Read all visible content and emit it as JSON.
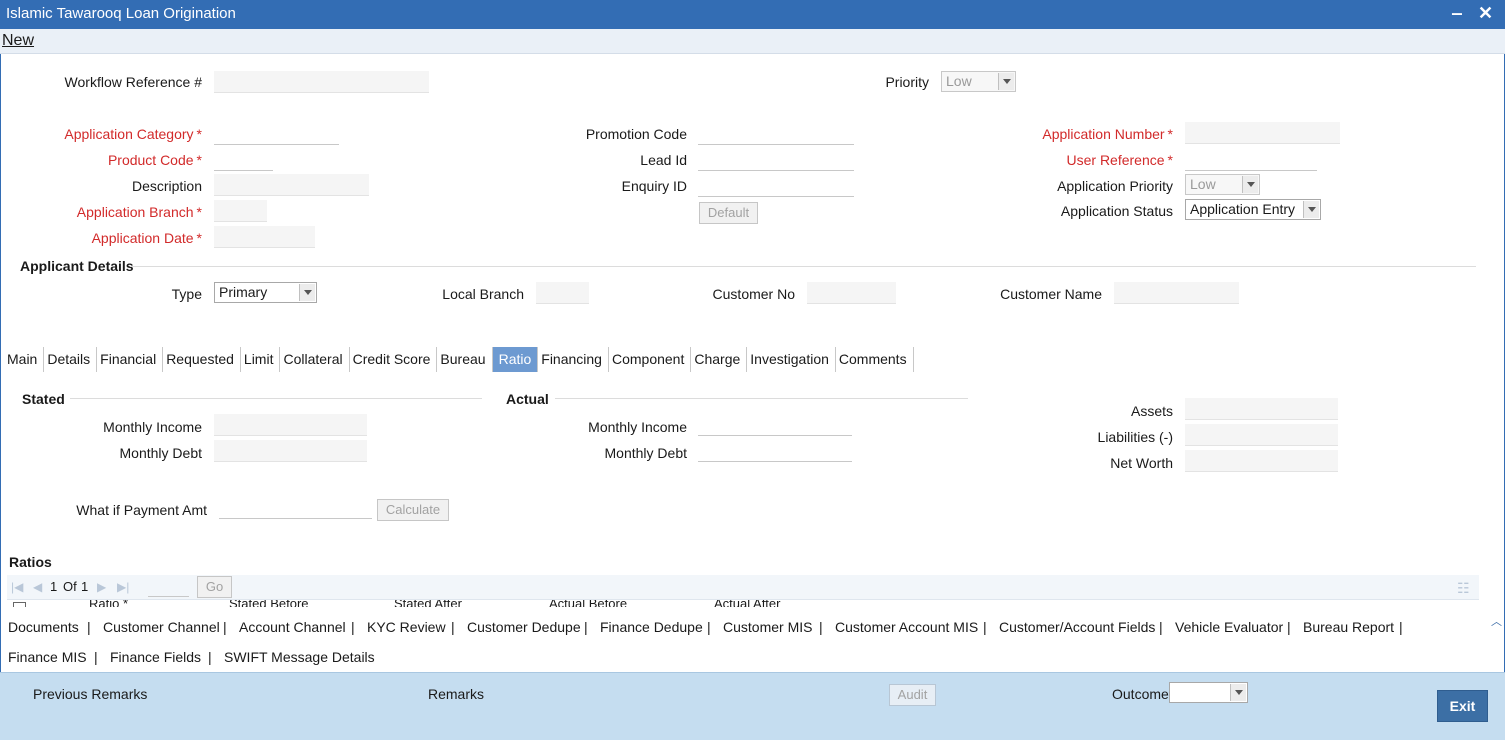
{
  "window": {
    "title": "Islamic Tawarooq Loan Origination",
    "minimize": "‒",
    "close": "✕"
  },
  "menu": {
    "new": "New"
  },
  "header": {
    "workflow_ref_label": "Workflow Reference #",
    "workflow_ref_value": "",
    "priority_label": "Priority",
    "priority_value": "Low"
  },
  "app": {
    "category_label": "Application Category",
    "product_code_label": "Product Code",
    "description_label": "Description",
    "branch_label": "Application Branch",
    "date_label": "Application Date",
    "promotion_code_label": "Promotion Code",
    "lead_id_label": "Lead Id",
    "enquiry_id_label": "Enquiry ID",
    "default_button": "Default",
    "app_number_label": "Application Number",
    "user_reference_label": "User Reference",
    "app_priority_label": "Application Priority",
    "app_priority_value": "Low",
    "app_status_label": "Application Status",
    "app_status_value": "Application Entry",
    "required_mark": "*"
  },
  "applicant": {
    "section_title": "Applicant Details",
    "type_label": "Type",
    "type_value": "Primary",
    "local_branch_label": "Local Branch",
    "customer_no_label": "Customer No",
    "customer_name_label": "Customer Name"
  },
  "tabs": [
    "Main",
    "Details",
    "Financial",
    "Requested",
    "Limit",
    "Collateral",
    "Credit Score",
    "Bureau",
    "Ratio",
    "Financing",
    "Component",
    "Charge",
    "Investigation",
    "Comments"
  ],
  "active_tab": "Ratio",
  "ratio": {
    "stated_title": "Stated",
    "actual_title": "Actual",
    "monthly_income_label": "Monthly Income",
    "monthly_debt_label": "Monthly Debt",
    "assets_label": "Assets",
    "liabilities_label": "Liabilities (-)",
    "net_worth_label": "Net Worth",
    "what_if_label": "What if Payment Amt",
    "calculate_button": "Calculate",
    "ratios_title": "Ratios",
    "pager_current": "1",
    "pager_of": "Of",
    "pager_total": "1",
    "go_button": "Go",
    "columns": [
      "Ratio *",
      "Stated Before",
      "Stated After",
      "Actual Before",
      "Actual After"
    ]
  },
  "links_row1": [
    "Documents",
    "Customer Channel",
    "Account Channel",
    "KYC Review",
    "Customer Dedupe",
    "Finance Dedupe",
    "Customer MIS",
    "Customer Account MIS",
    "Customer/Account Fields",
    "Vehicle Evaluator",
    "Bureau Report"
  ],
  "links_row2": [
    "Finance MIS",
    "Finance Fields",
    "SWIFT Message Details"
  ],
  "separator": "|",
  "footer": {
    "previous_remarks": "Previous Remarks",
    "remarks": "Remarks",
    "audit_button": "Audit",
    "outcome_label": "Outcome",
    "outcome_value": "",
    "exit_button": "Exit"
  },
  "colors": {
    "title_bar": "#336db4",
    "active_tab": "#6d9ad1",
    "required": "#d22a2a",
    "footer": "#c5ddf0",
    "exit_button": "#3c6fa5"
  }
}
